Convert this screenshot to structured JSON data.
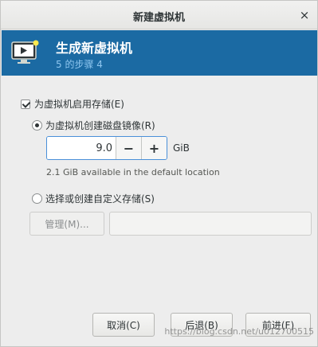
{
  "window": {
    "title": "新建虚拟机",
    "close_glyph": "×"
  },
  "banner": {
    "title": "生成新虚拟机",
    "step": "5 的步骤 4",
    "background": "#1b6aa3"
  },
  "storage": {
    "enable_label": "为虚拟机启用存储(E)",
    "enable_checked": true,
    "create_disk_label": "为虚拟机创建磁盘镜像(R)",
    "create_disk_selected": true,
    "size_value": "9.0",
    "size_unit": "GiB",
    "decrement": "−",
    "increment": "+",
    "available_text": "2.1 GiB available in the default location",
    "custom_label": "选择或创建自定义存储(S)",
    "custom_selected": false,
    "manage_button": "管理(M)...",
    "custom_path_value": ""
  },
  "footer": {
    "cancel": "取消(C)",
    "back": "后退(B)",
    "forward": "前进(F)"
  },
  "watermark": "https://blog.csdn.net/u012700515"
}
